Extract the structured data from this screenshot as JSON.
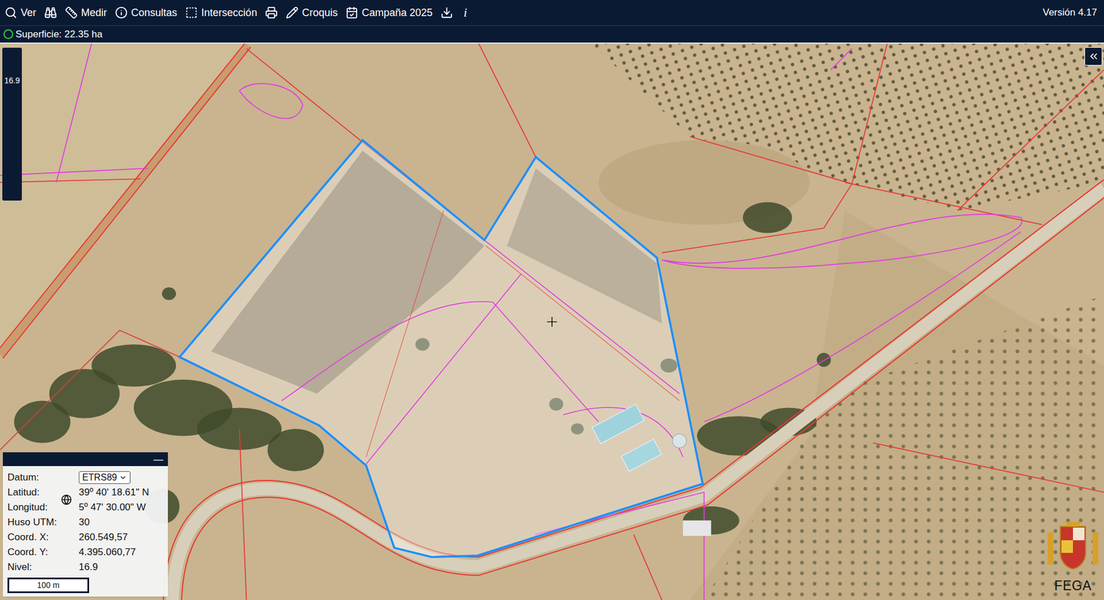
{
  "toolbar": {
    "items": [
      {
        "kind": "labeled",
        "label": "Ver"
      },
      {
        "kind": "icon",
        "label": ""
      },
      {
        "kind": "labeled",
        "label": "Medir"
      },
      {
        "kind": "labeled",
        "label": "Consultas"
      },
      {
        "kind": "labeled",
        "label": "Intersección"
      },
      {
        "kind": "icon",
        "label": ""
      },
      {
        "kind": "labeled",
        "label": "Croquis"
      },
      {
        "kind": "labeled",
        "label": "Campaña 2025"
      },
      {
        "kind": "icon",
        "label": ""
      },
      {
        "kind": "glyph",
        "label": "i"
      }
    ],
    "version": "Versión 4.17"
  },
  "status_bar": {
    "text": "Superficie: 22.35 ha",
    "ok": true
  },
  "zoom": {
    "level": "16.9"
  },
  "coord_panel": {
    "minimize": "—",
    "datum": {
      "label": "Datum:",
      "value": "ETRS89"
    },
    "rows": [
      {
        "label": "Latitud:",
        "value": "39º 40' 18.61\" N"
      },
      {
        "label": "Longitud:",
        "value": "5º 47' 30.00\" W"
      },
      {
        "label": "Huso UTM:",
        "value": "30"
      },
      {
        "label": "Coord. X:",
        "value": "260.549,57"
      },
      {
        "label": "Coord. Y:",
        "value": "4.395.060,77"
      },
      {
        "label": "Nivel:",
        "value": "16.9"
      }
    ],
    "scale": "100 m"
  },
  "logo": {
    "text": "FEGA"
  }
}
